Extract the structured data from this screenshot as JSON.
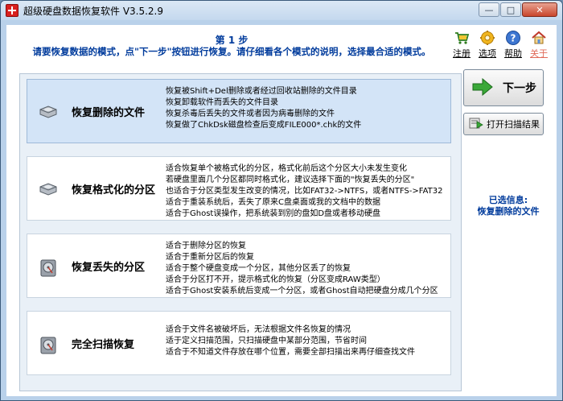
{
  "window": {
    "title": "超级硬盘数据恢复软件 V3.5.2.9",
    "controls": {
      "minimize": "—",
      "maximize": "□",
      "close": "✕"
    }
  },
  "header": {
    "step": "第 1 步",
    "instruction": "请要恢复数据的模式，点\"下一步\"按钮进行恢复。请仔细看各个模式的说明，选择最合适的模式。"
  },
  "toolbar": [
    {
      "id": "register",
      "label": "注册",
      "icon": "cart-icon"
    },
    {
      "id": "options",
      "label": "选项",
      "icon": "gear-icon"
    },
    {
      "id": "help",
      "label": "帮助",
      "icon": "help-icon"
    },
    {
      "id": "about",
      "label": "关于",
      "icon": "home-icon"
    }
  ],
  "modes": [
    {
      "name": "恢复删除的文件",
      "selected": true,
      "lines": [
        "恢复被Shift+Del删除或者经过回收站删除的文件目录",
        "恢复卸载软件而丢失的文件目录",
        "恢复杀毒后丢失的文件或者因为病毒删除的文件",
        "恢复做了ChkDsk磁盘检查后变成FILE000*.chk的文件"
      ]
    },
    {
      "name": "恢复格式化的分区",
      "selected": false,
      "lines": [
        "适合恢复单个被格式化的分区，格式化前后这个分区大小未发生变化",
        "若硬盘里面几个分区都同时格式化，建议选择下面的\"恢复丢失的分区\"",
        "也适合于分区类型发生改变的情况，比如FAT32->NTFS，或者NTFS->FAT32",
        "适合于重装系统后，丢失了原来C盘桌面或我的文档中的数据",
        "适合于Ghost误操作，把系统装到别的盘如D盘或者移动硬盘"
      ]
    },
    {
      "name": "恢复丢失的分区",
      "selected": false,
      "lines": [
        "适合于删除分区的恢复",
        "适合于重新分区后的恢复",
        "适合于整个硬盘变成一个分区，其他分区丢了的恢复",
        "适合于分区打不开，提示格式化的恢复（分区变成RAW类型）",
        "适合于Ghost安装系统后变成一个分区，或者Ghost自动把硬盘分成几个分区"
      ]
    },
    {
      "name": "完全扫描恢复",
      "selected": false,
      "lines": [
        "适合于文件名被破坏后，无法根据文件名恢复的情况",
        "适于定义扫描范围，只扫描硬盘中某部分范围，节省时间",
        "适合于不知道文件存放在哪个位置，需要全部扫描出来再仔细查找文件"
      ]
    }
  ],
  "side": {
    "next_label": "下一步",
    "open_label": "打开扫描结果",
    "selected_title": "已选信息:",
    "selected_value": "恢复删除的文件"
  },
  "colors": {
    "accent": "#003b9c",
    "selected_bg": "#d3e4f7",
    "about_label": "#e06b5a"
  }
}
